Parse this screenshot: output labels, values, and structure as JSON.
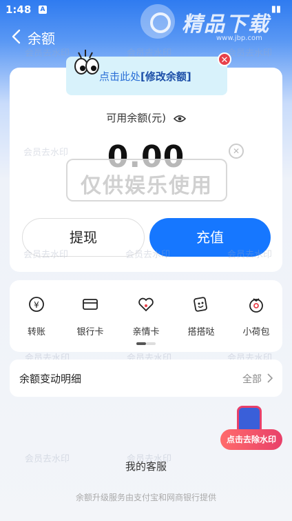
{
  "status_bar": {
    "time": "1:48",
    "app_badge": "A"
  },
  "watermark_logo": {
    "text": "精品下载",
    "url": "www.jbp.com"
  },
  "nav": {
    "title": "余额"
  },
  "tooltip": {
    "prefix": "点击此处",
    "action": "[修改余额]"
  },
  "balance": {
    "label": "可用余额(元)",
    "amount": "0.00"
  },
  "stamp": {
    "text": "仅供娱乐使用"
  },
  "buttons": {
    "withdraw": "提现",
    "recharge": "充值"
  },
  "services": [
    {
      "label": "转账",
      "icon": "yen-transfer-icon"
    },
    {
      "label": "银行卡",
      "icon": "bank-card-icon"
    },
    {
      "label": "亲情卡",
      "icon": "heart-card-icon"
    },
    {
      "label": "搭搭哒",
      "icon": "sticker-icon"
    },
    {
      "label": "小荷包",
      "icon": "purse-icon"
    }
  ],
  "history": {
    "label": "余额变动明细",
    "link": "全部"
  },
  "overlay_watermark": "会员去水印",
  "remove_watermark_button": "点击去除水印",
  "customer_service": "我的客服",
  "footer": "余额升级服务由支付宝和网商银行提供",
  "colors": {
    "primary": "#1677ff",
    "tooltip_bg": "#d8f2fb",
    "close_red": "#e8404a"
  }
}
